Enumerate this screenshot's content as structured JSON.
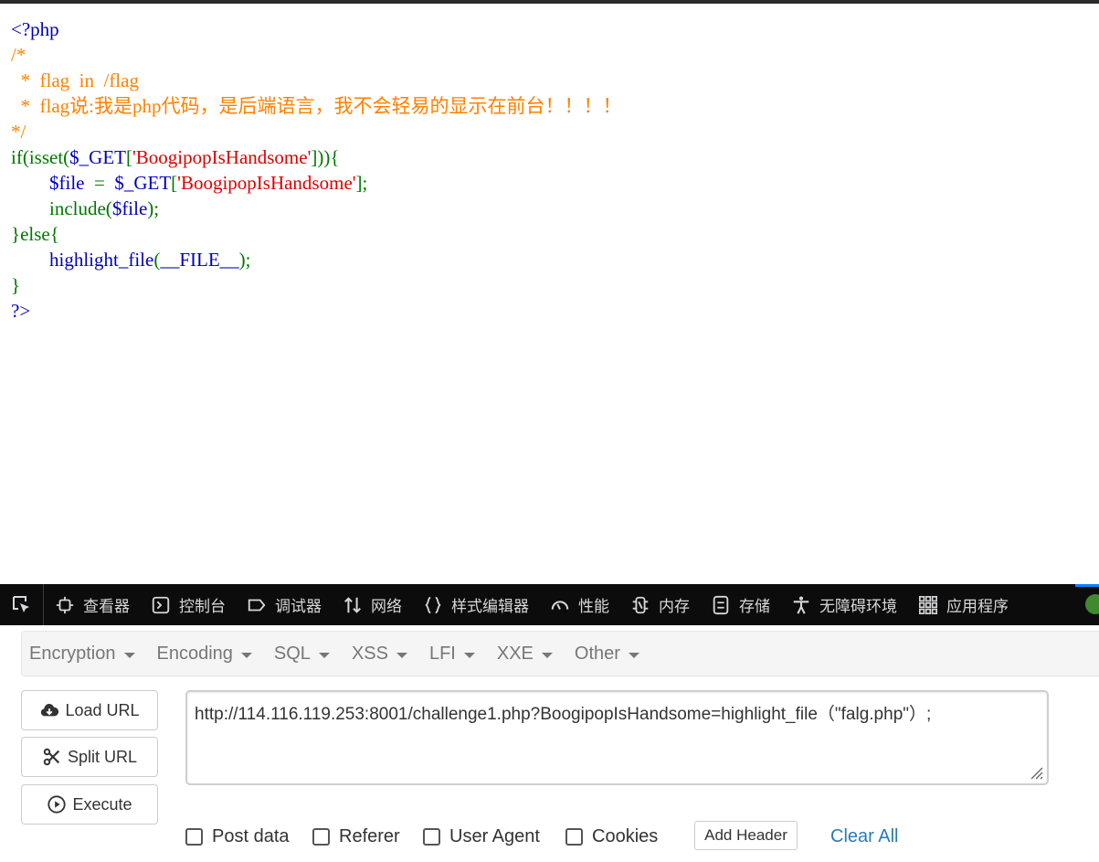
{
  "code": {
    "lines": [
      [
        {
          "t": "<?php",
          "c": "def"
        }
      ],
      [
        {
          "t": "/*",
          "c": "cmt"
        }
      ],
      [
        {
          "t": "  *  flag  in  /flag",
          "c": "cmt"
        }
      ],
      [
        {
          "t": "  *  flag说:我是php代码，是后端语言，我不会轻易的显示在前台！！！！",
          "c": "cmt"
        }
      ],
      [
        {
          "t": "*/",
          "c": "cmt"
        }
      ],
      [
        {
          "t": "if(isset(",
          "c": "kw"
        },
        {
          "t": "$_GET",
          "c": "def"
        },
        {
          "t": "[",
          "c": "kw"
        },
        {
          "t": "'BoogipopIsHandsome'",
          "c": "str"
        },
        {
          "t": "])){",
          "c": "kw"
        }
      ],
      [
        {
          "t": "        ",
          "c": "kw"
        },
        {
          "t": "$file  ",
          "c": "def"
        },
        {
          "t": "=  ",
          "c": "kw"
        },
        {
          "t": "$_GET",
          "c": "def"
        },
        {
          "t": "[",
          "c": "kw"
        },
        {
          "t": "'BoogipopIsHandsome'",
          "c": "str"
        },
        {
          "t": "];",
          "c": "kw"
        }
      ],
      [
        {
          "t": "        include(",
          "c": "kw"
        },
        {
          "t": "$file",
          "c": "def"
        },
        {
          "t": ");",
          "c": "kw"
        }
      ],
      [
        {
          "t": "}else{",
          "c": "kw"
        }
      ],
      [
        {
          "t": "        ",
          "c": "kw"
        },
        {
          "t": "highlight_file",
          "c": "def"
        },
        {
          "t": "(",
          "c": "kw"
        },
        {
          "t": "__FILE__",
          "c": "def"
        },
        {
          "t": ");",
          "c": "kw"
        }
      ],
      [
        {
          "t": "}",
          "c": "kw"
        }
      ],
      [
        {
          "t": "?>",
          "c": "def"
        }
      ]
    ]
  },
  "devtools": {
    "tabs": [
      {
        "label": "查看器",
        "icon": "inspector-icon"
      },
      {
        "label": "控制台",
        "icon": "console-icon"
      },
      {
        "label": "调试器",
        "icon": "debugger-icon"
      },
      {
        "label": "网络",
        "icon": "network-icon"
      },
      {
        "label": "样式编辑器",
        "icon": "style-editor-icon"
      },
      {
        "label": "性能",
        "icon": "performance-icon"
      },
      {
        "label": "内存",
        "icon": "memory-icon"
      },
      {
        "label": "存储",
        "icon": "storage-icon"
      },
      {
        "label": "无障碍环境",
        "icon": "accessibility-icon"
      },
      {
        "label": "应用程序",
        "icon": "application-icon"
      }
    ]
  },
  "hackbar": {
    "menu": [
      "Encryption",
      "Encoding",
      "SQL",
      "XSS",
      "LFI",
      "XXE",
      "Other"
    ],
    "load_url": "Load URL",
    "split_url": "Split URL",
    "execute": "Execute",
    "url": "http://114.116.119.253:8001/challenge1.php?BoogipopIsHandsome=highlight_file（\"falg.php\"）;",
    "options": [
      "Post data",
      "Referer",
      "User Agent",
      "Cookies"
    ],
    "add_header": "Add Header",
    "clear_all": "Clear All"
  },
  "colors": {
    "php_default": "#0000bb",
    "php_comment": "#ff8000",
    "php_keyword": "#007700",
    "php_string": "#dd0000",
    "devtools_bg": "#0c0c0d",
    "link_blue": "#2a7ab8"
  }
}
